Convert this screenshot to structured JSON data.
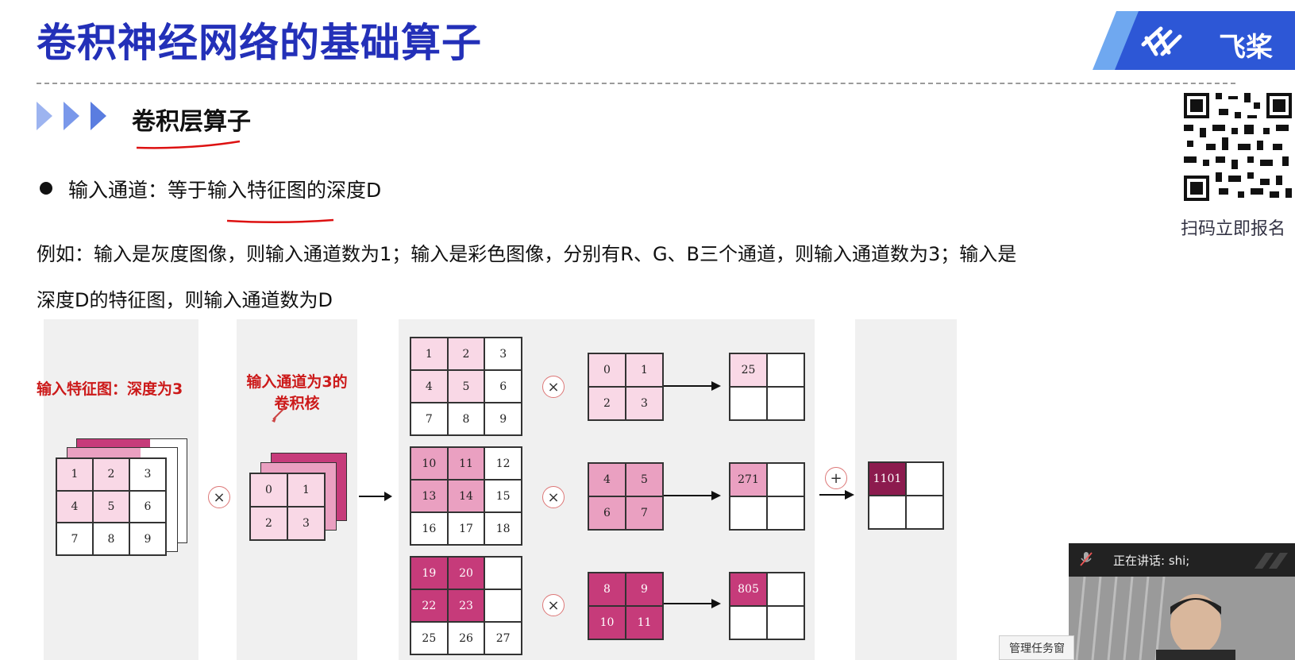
{
  "slide": {
    "title": "卷积神经网络的基础算子",
    "brand": "飞桨",
    "subtitle": "卷积层算子",
    "bullet": "输入通道：等于输入特征图的深度D",
    "para_line1": "例如：输入是灰度图像，则输入通道数为1；输入是彩色图像，分别有R、G、B三个通道，则输入通道数为3；输入是",
    "para_line2": "深度D的特征图，则输入通道数为D",
    "qr_caption": "扫码立即报名"
  },
  "figure": {
    "label_input": "输入特征图：深度为3",
    "label_kernel_line1": "输入通道为3的",
    "label_kernel_line2": "卷积核",
    "input_grid": [
      "1",
      "2",
      "3",
      "4",
      "5",
      "6",
      "7",
      "8",
      "9"
    ],
    "kernel_grid": [
      "0",
      "1",
      "2",
      "3"
    ],
    "channel1": [
      "1",
      "2",
      "3",
      "4",
      "5",
      "6",
      "7",
      "8",
      "9"
    ],
    "channel2": [
      "10",
      "11",
      "12",
      "13",
      "14",
      "15",
      "16",
      "17",
      "18"
    ],
    "channel3": [
      "19",
      "20",
      "",
      "22",
      "23",
      "",
      "25",
      "26",
      "27"
    ],
    "kernel1": [
      "0",
      "1",
      "2",
      "3"
    ],
    "kernel2": [
      "4",
      "5",
      "6",
      "7"
    ],
    "kernel3": [
      "8",
      "9",
      "10",
      "11"
    ],
    "out1": [
      "25",
      "",
      "",
      ""
    ],
    "out2": [
      "271",
      "",
      "",
      ""
    ],
    "out3": [
      "805",
      "",
      "",
      ""
    ],
    "final": [
      "1101",
      "",
      "",
      ""
    ],
    "times": "×",
    "plus": "+"
  },
  "meeting": {
    "speaking": "正在讲话: shi;",
    "task_button": "管理任务窗"
  },
  "colors": {
    "title_blue": "#2330b8",
    "pink_light": "#f9d8e6",
    "pink_mid": "#eaa0c1",
    "pink_dark": "#c63b7a",
    "pink_deep": "#8c1b4e",
    "annotation_red": "#cc1a1a"
  }
}
